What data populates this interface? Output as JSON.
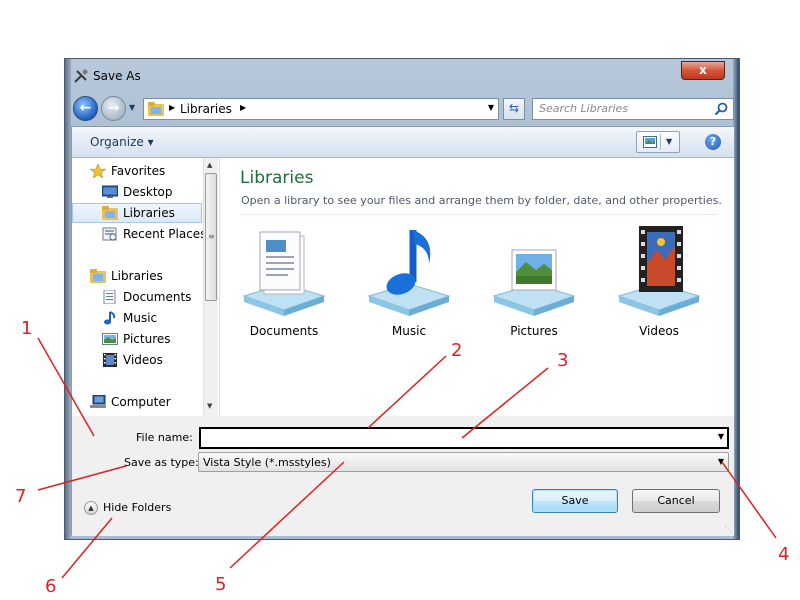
{
  "window": {
    "title": "Save As",
    "close_glyph": "x"
  },
  "navigation": {
    "address_text": "Libraries",
    "search_placeholder": "Search Libraries"
  },
  "toolbar": {
    "organize_label": "Organize ▾",
    "help_glyph": "?"
  },
  "sidebar": {
    "items": [
      {
        "label": "Favorites",
        "icon": "star-icon"
      },
      {
        "label": "Desktop",
        "icon": "desktop-icon"
      },
      {
        "label": "Libraries",
        "icon": "libraries-icon",
        "selected": true
      },
      {
        "label": "Recent Places",
        "icon": "recent-places-icon"
      },
      {
        "label": "Libraries",
        "icon": "libraries-icon"
      },
      {
        "label": "Documents",
        "icon": "documents-icon"
      },
      {
        "label": "Music",
        "icon": "music-icon"
      },
      {
        "label": "Pictures",
        "icon": "pictures-icon"
      },
      {
        "label": "Videos",
        "icon": "videos-icon"
      },
      {
        "label": "Computer",
        "icon": "computer-icon"
      }
    ]
  },
  "content": {
    "title": "Libraries",
    "description": "Open a library to see your files and arrange them by folder, date, and other properties.",
    "libraries": [
      {
        "label": "Documents",
        "icon": "documents-library-icon"
      },
      {
        "label": "Music",
        "icon": "music-library-icon"
      },
      {
        "label": "Pictures",
        "icon": "pictures-library-icon"
      },
      {
        "label": "Videos",
        "icon": "videos-library-icon"
      }
    ]
  },
  "form": {
    "file_name_label": "File name:",
    "file_name_value": "",
    "save_as_type_label": "Save as type:",
    "save_as_type_value": "Vista Style (*.msstyles)",
    "hide_folders_label": "Hide Folders",
    "save_label": "Save",
    "cancel_label": "Cancel"
  },
  "annotations": [
    "1",
    "2",
    "3",
    "4",
    "5",
    "6",
    "7"
  ],
  "colors": {
    "annotation": "#e02020",
    "library_title": "#1e6e3c",
    "close_button": "#c9442a"
  }
}
